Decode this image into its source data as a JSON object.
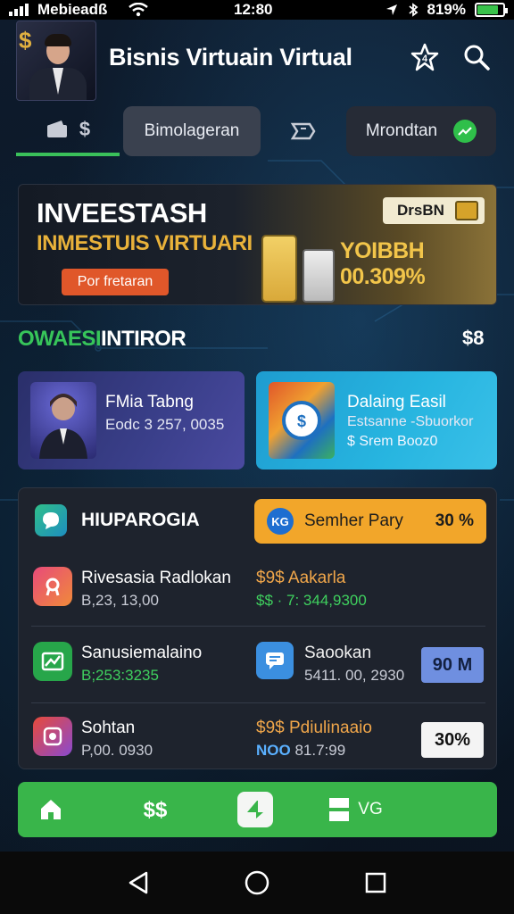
{
  "status_bar": {
    "carrier": "Mebieadß",
    "time": "12:80",
    "battery_pct": "819%",
    "battery_level": 0.82,
    "icons": [
      "signal-icon",
      "wifi-icon",
      "location-icon",
      "bluetooth-icon",
      "battery-icon"
    ]
  },
  "header": {
    "title": "Bisnis Virtuain Virtual",
    "icons": [
      "star-icon",
      "search-icon"
    ]
  },
  "tabs": {
    "home_symbol": "$",
    "tab1": "Bimolageran",
    "tab3": "Mrondtan"
  },
  "banner": {
    "title": "INVEESTASH",
    "subtitle": "INMESTUIS VIRTUARI",
    "button": "Por fretaran",
    "badge": "DrsBN",
    "rate": "YOIBBH 00.309%"
  },
  "section": {
    "title_green": "OWAESI",
    "title_white": "INTIROR",
    "right": "$8"
  },
  "cards": [
    {
      "title": "FMia Tabng",
      "subtitle": "Eodc 3 257, 0035"
    },
    {
      "title": "Dalaing Easil",
      "subtitle": "Estsanne -Sbuorkor",
      "line3": "$ Srem Booz0"
    }
  ],
  "panel": {
    "title": "HIUPAROGIA",
    "pill_logo": "KG",
    "pill_label": "Semher Pary",
    "pill_pct": "30 %",
    "rows": [
      {
        "name": "Rivesasia Radlokan",
        "value": "B,23, 13,00",
        "right_name": "$9$ Aakarla",
        "right_value": "$$ · 7: 344,9300"
      },
      {
        "name": "Sanusiemalaino",
        "value": "B;253:3235",
        "right_name": "Saookan",
        "right_value": "5411. 00, 2930",
        "badge": "90 M"
      },
      {
        "name": "Sohtan",
        "value": "P,00. 0930",
        "right_name": "$9$ Pdiulinaaio",
        "right_value_prefix": "NOO",
        "right_value": "81.7:99",
        "badge": "30%"
      }
    ]
  },
  "app_bar": {
    "label": "VG",
    "icons": [
      "home-icon",
      "money-icon",
      "center-action-icon",
      "layers-icon"
    ]
  },
  "colors": {
    "accent_green": "#39b54a",
    "accent_gold": "#f2a62a",
    "background": "#0c1a2b"
  }
}
